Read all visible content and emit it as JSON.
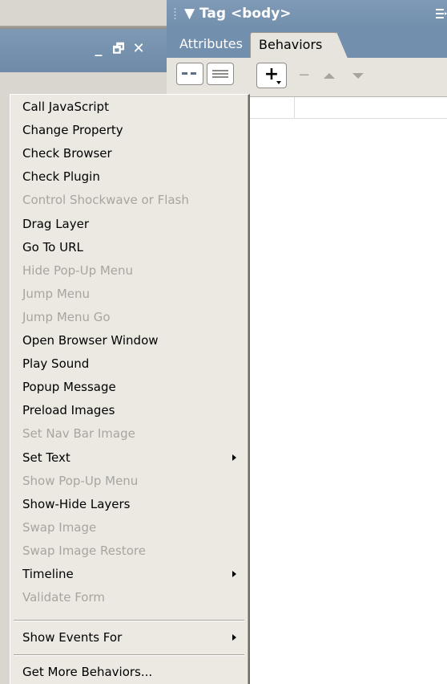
{
  "left_panel": {
    "minimize_glyph": "_",
    "restore_glyph": "🗗",
    "close_glyph": "✕"
  },
  "inspector": {
    "title": "Tag <body>",
    "title_arrow": "▼",
    "tabs": [
      {
        "label": "Attributes",
        "active": false
      },
      {
        "label": "Behaviors",
        "active": true
      }
    ],
    "toolbar": {
      "add_glyph": "+",
      "remove_glyph": "−"
    }
  },
  "menu": {
    "items": [
      {
        "label": "Call JavaScript",
        "enabled": true,
        "submenu": false
      },
      {
        "label": "Change Property",
        "enabled": true,
        "submenu": false
      },
      {
        "label": "Check Browser",
        "enabled": true,
        "submenu": false
      },
      {
        "label": "Check Plugin",
        "enabled": true,
        "submenu": false
      },
      {
        "label": "Control Shockwave or Flash",
        "enabled": false,
        "submenu": false
      },
      {
        "label": "Drag Layer",
        "enabled": true,
        "submenu": false
      },
      {
        "label": "Go To URL",
        "enabled": true,
        "submenu": false
      },
      {
        "label": "Hide Pop-Up Menu",
        "enabled": false,
        "submenu": false
      },
      {
        "label": "Jump Menu",
        "enabled": false,
        "submenu": false
      },
      {
        "label": "Jump Menu Go",
        "enabled": false,
        "submenu": false
      },
      {
        "label": "Open Browser Window",
        "enabled": true,
        "submenu": false
      },
      {
        "label": "Play Sound",
        "enabled": true,
        "submenu": false
      },
      {
        "label": "Popup Message",
        "enabled": true,
        "submenu": false
      },
      {
        "label": "Preload Images",
        "enabled": true,
        "submenu": false
      },
      {
        "label": "Set Nav Bar Image",
        "enabled": false,
        "submenu": false
      },
      {
        "label": "Set Text",
        "enabled": true,
        "submenu": true
      },
      {
        "label": "Show Pop-Up Menu",
        "enabled": false,
        "submenu": false
      },
      {
        "label": "Show-Hide Layers",
        "enabled": true,
        "submenu": false
      },
      {
        "label": "Swap Image",
        "enabled": false,
        "submenu": false
      },
      {
        "label": "Swap Image Restore",
        "enabled": false,
        "submenu": false
      },
      {
        "label": "Timeline",
        "enabled": true,
        "submenu": true
      },
      {
        "label": "Validate Form",
        "enabled": false,
        "submenu": false
      }
    ],
    "show_events_for": {
      "label": "Show Events For",
      "enabled": true,
      "submenu": true
    },
    "get_more": {
      "label": "Get More Behaviors...",
      "enabled": true,
      "submenu": false
    }
  }
}
